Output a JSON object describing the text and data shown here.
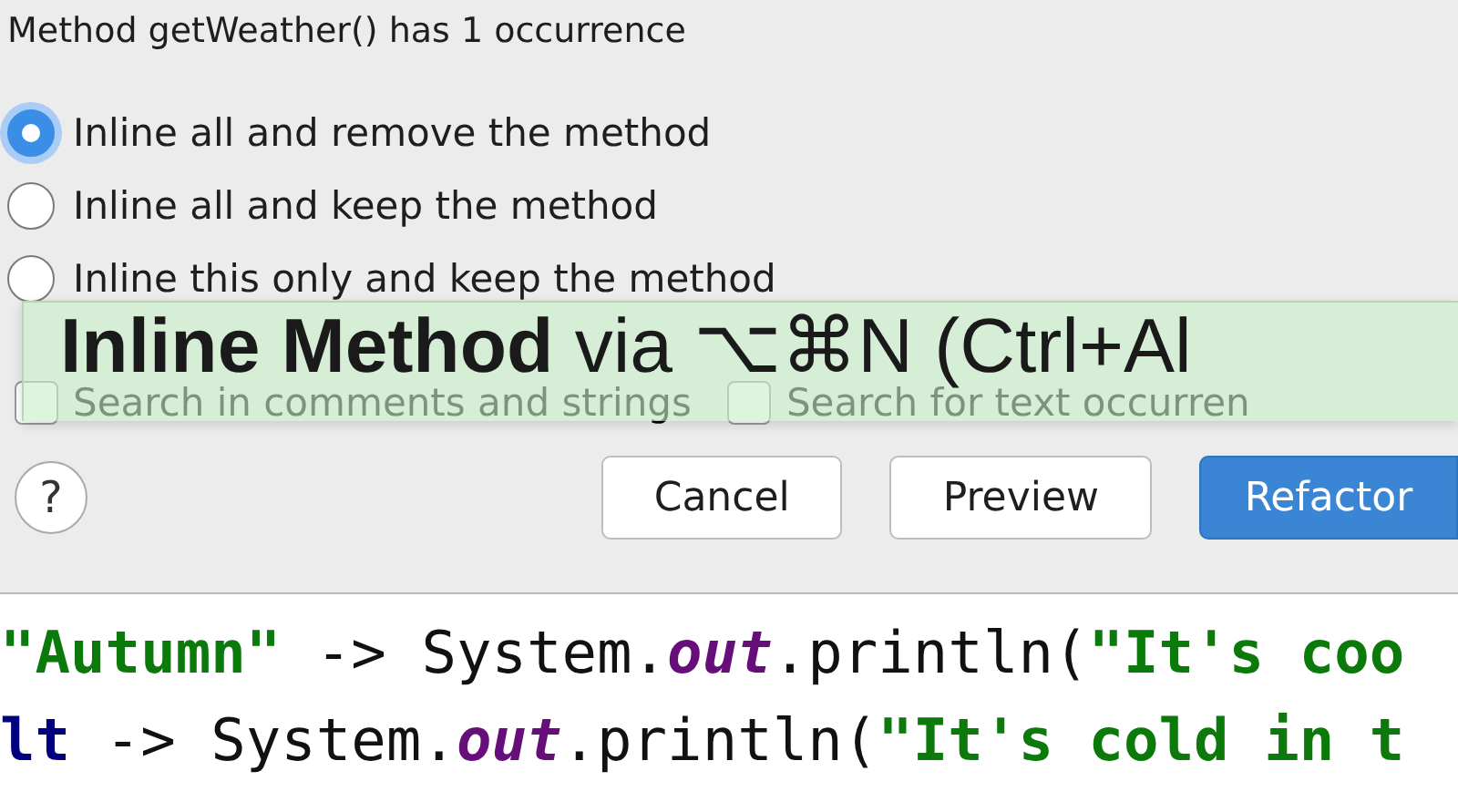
{
  "dialog": {
    "heading": "Method getWeather() has 1 occurrence",
    "options": [
      {
        "label": "Inline all and remove the method",
        "selected": true
      },
      {
        "label": "Inline all and keep the method",
        "selected": false
      },
      {
        "label": "Inline this only and keep the method",
        "selected": false
      }
    ],
    "checkboxes": [
      {
        "label": "Search in comments and strings",
        "checked": false
      },
      {
        "label": "Search for text occurren",
        "checked": false
      }
    ],
    "help": "?",
    "buttons": [
      {
        "label": "Cancel",
        "kind": "default"
      },
      {
        "label": "Preview",
        "kind": "default"
      },
      {
        "label": "Refactor",
        "kind": "primary"
      }
    ]
  },
  "tooltip": "**Inline Method** via ⌥⌘N (Ctrl+Al",
  "code": [
    [
      {
        "text": "\"Autumn\"",
        "kind": "string"
      },
      {
        "text": " -> System.",
        "kind": "plain"
      },
      {
        "text": "out",
        "kind": "field"
      },
      {
        "text": ".println(",
        "kind": "plain"
      },
      {
        "text": "\"It's coo",
        "kind": "string"
      }
    ],
    [
      {
        "text": "lt",
        "kind": "keyword"
      },
      {
        "text": " -> System.",
        "kind": "plain"
      },
      {
        "text": "out",
        "kind": "field"
      },
      {
        "text": ".println(",
        "kind": "plain"
      },
      {
        "text": "\"It's cold in t",
        "kind": "string"
      }
    ]
  ]
}
